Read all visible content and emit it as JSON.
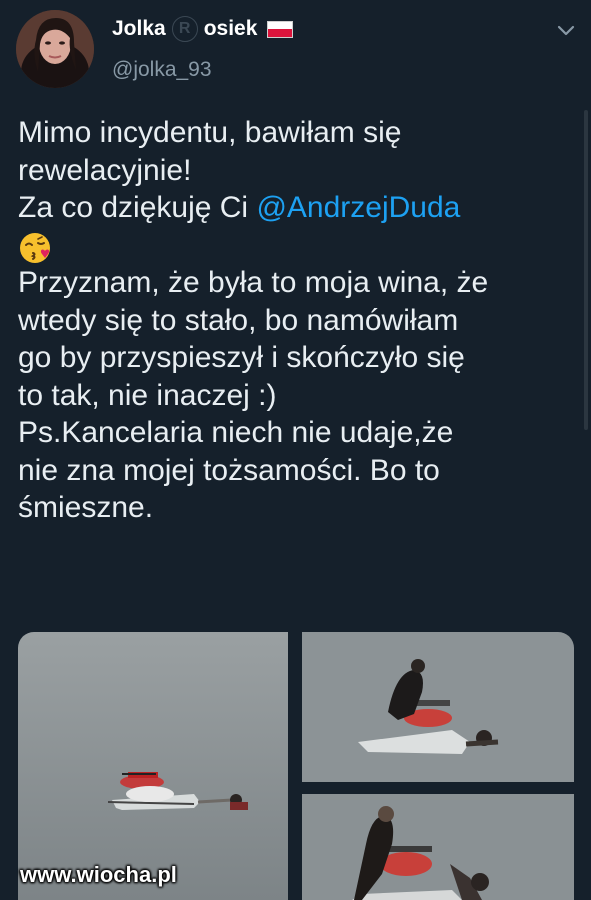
{
  "user": {
    "name_part1": "Jolka",
    "name_registered": "R",
    "name_part2": "osiek",
    "handle": "@jolka_93"
  },
  "icons": {
    "flag": "poland-flag-icon",
    "menu": "chevron-down-icon",
    "emoji": "face-blowing-kiss-emoji"
  },
  "tweet": {
    "line1": "Mimo incydentu, bawiłam się",
    "line2": "rewelacyjnie!",
    "line3_prefix": "Za co dziękuję Ci ",
    "line3_mention": "@AndrzejDuda",
    "line5": "Przyznam, że była to moja wina, że",
    "line6": "wtedy się to stało, bo namówiłam",
    "line7": "go by przyspieszył i skończyło się",
    "line8": "to tak, nie inaczej :)",
    "line9": "Ps.Kancelaria niech nie udaje,że",
    "line10": "nie zna mojej tożsamości. Bo to",
    "line11": "śmieszne."
  },
  "watermark": "www.wiocha.pl",
  "colors": {
    "background": "#15202b",
    "text": "#e8eef2",
    "mention": "#1da1f2",
    "secondary": "#8899a6"
  }
}
